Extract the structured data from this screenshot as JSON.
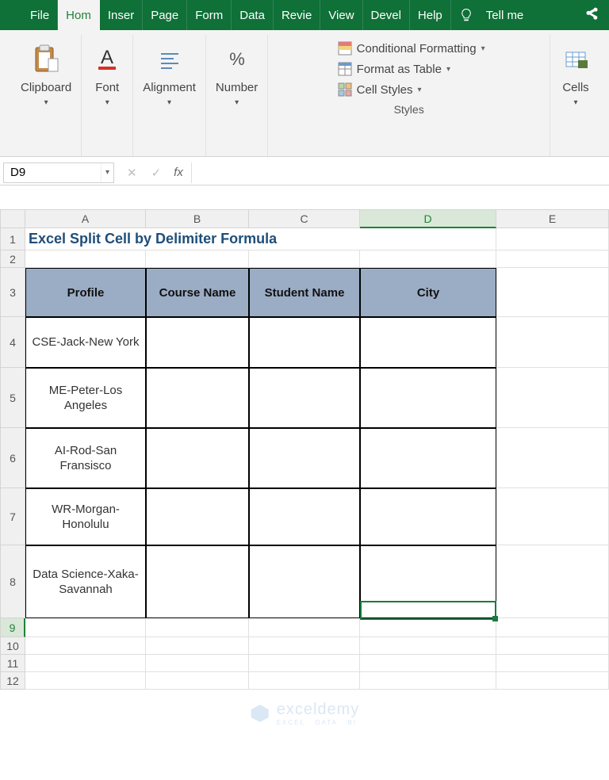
{
  "tabs": {
    "file": "File",
    "home": "Hom",
    "insert": "Inser",
    "page": "Page",
    "form": "Form",
    "data": "Data",
    "review": "Revie",
    "view": "View",
    "devel": "Devel",
    "help": "Help",
    "tellme": "Tell me"
  },
  "ribbon": {
    "clipboard": {
      "label": "Clipboard"
    },
    "font": {
      "label": "Font"
    },
    "alignment": {
      "label": "Alignment"
    },
    "number": {
      "label": "Number"
    },
    "styles": {
      "label": "Styles",
      "cond_fmt": "Conditional Formatting",
      "fmt_table": "Format as Table",
      "cell_styles": "Cell Styles"
    },
    "cells": {
      "label": "Cells"
    }
  },
  "namebox": "D9",
  "formula": "",
  "columns": [
    "A",
    "B",
    "C",
    "D",
    "E"
  ],
  "col_widths": {
    "A": 152,
    "B": 130,
    "C": 140,
    "D": 172,
    "E": 96
  },
  "row_heights": {
    "1": 28,
    "2": 22,
    "3": 62,
    "4": 64,
    "5": 76,
    "6": 76,
    "7": 72,
    "8": 92,
    "9": 24,
    "10": 22,
    "11": 22,
    "12": 22
  },
  "title": "Excel Split Cell by Delimiter Formula",
  "headers": {
    "profile": "Profile",
    "course": "Course Name",
    "student": "Student Name",
    "city": "City"
  },
  "rows": [
    {
      "profile": "CSE-Jack-New York"
    },
    {
      "profile": "ME-Peter-Los Angeles"
    },
    {
      "profile": "AI-Rod-San Fransisco"
    },
    {
      "profile": "WR-Morgan-Honolulu"
    },
    {
      "profile": "Data Science-Xaka-Savannah"
    }
  ],
  "selected_cell": "D9",
  "watermark": {
    "brand": "exceldemy",
    "sub": "EXCEL · DATA · BI"
  },
  "chart_data": {
    "type": "table",
    "title": "Excel Split Cell by Delimiter Formula",
    "columns": [
      "Profile",
      "Course Name",
      "Student Name",
      "City"
    ],
    "rows": [
      [
        "CSE-Jack-New York",
        "",
        "",
        ""
      ],
      [
        "ME-Peter-Los Angeles",
        "",
        "",
        ""
      ],
      [
        "AI-Rod-San Fransisco",
        "",
        "",
        ""
      ],
      [
        "WR-Morgan-Honolulu",
        "",
        "",
        ""
      ],
      [
        "Data Science-Xaka-Savannah",
        "",
        "",
        ""
      ]
    ]
  }
}
